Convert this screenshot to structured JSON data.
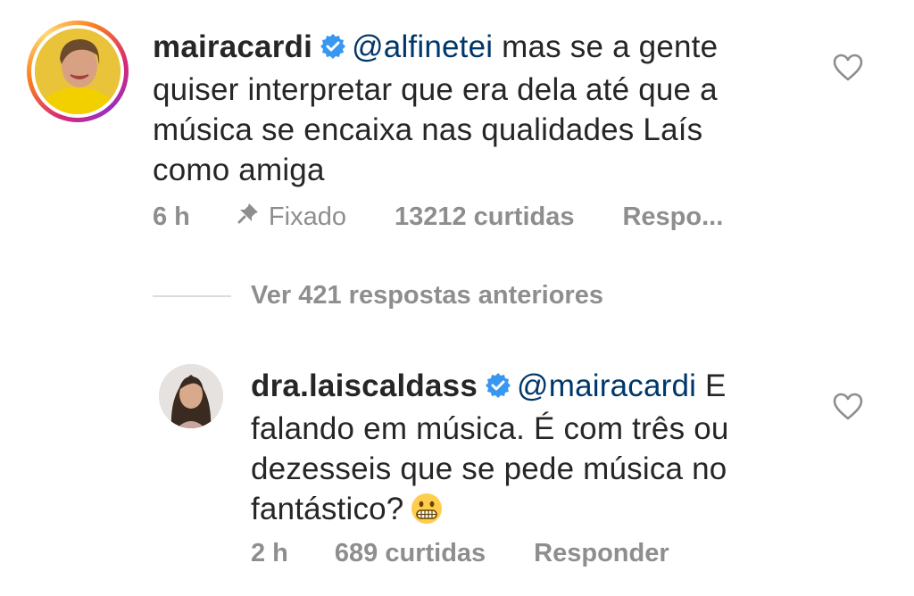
{
  "comments": [
    {
      "username": "mairacardi",
      "mention": "@alfinetei",
      "text": " mas se a gente quiser interpretar que era dela até que a música se encaixa nas qualidades Laís como amiga",
      "time": "6 h",
      "pinned_label": "Fixado",
      "likes": "13212 curtidas",
      "reply_label": "Respo...",
      "icons": {
        "verified": "verified-badge-icon",
        "like": "heart-icon",
        "pin": "pin-icon"
      }
    },
    {
      "username": "dra.laiscaldass",
      "mention": "@mairacardi",
      "text": " E falando em música. É com três ou dezesseis que se pede música no fantástico?",
      "emoji": "grimacing-face-emoji",
      "time": "2 h",
      "likes": "689 curtidas",
      "reply_label": "Responder",
      "icons": {
        "verified": "verified-badge-icon",
        "like": "heart-icon"
      }
    }
  ],
  "thread": {
    "view_previous_label": "Ver 421 respostas anteriores"
  },
  "colors": {
    "mention": "#00376b",
    "secondary_text": "#8e8e8e",
    "verified": "#3897f0",
    "story_ring": "#d62976"
  }
}
